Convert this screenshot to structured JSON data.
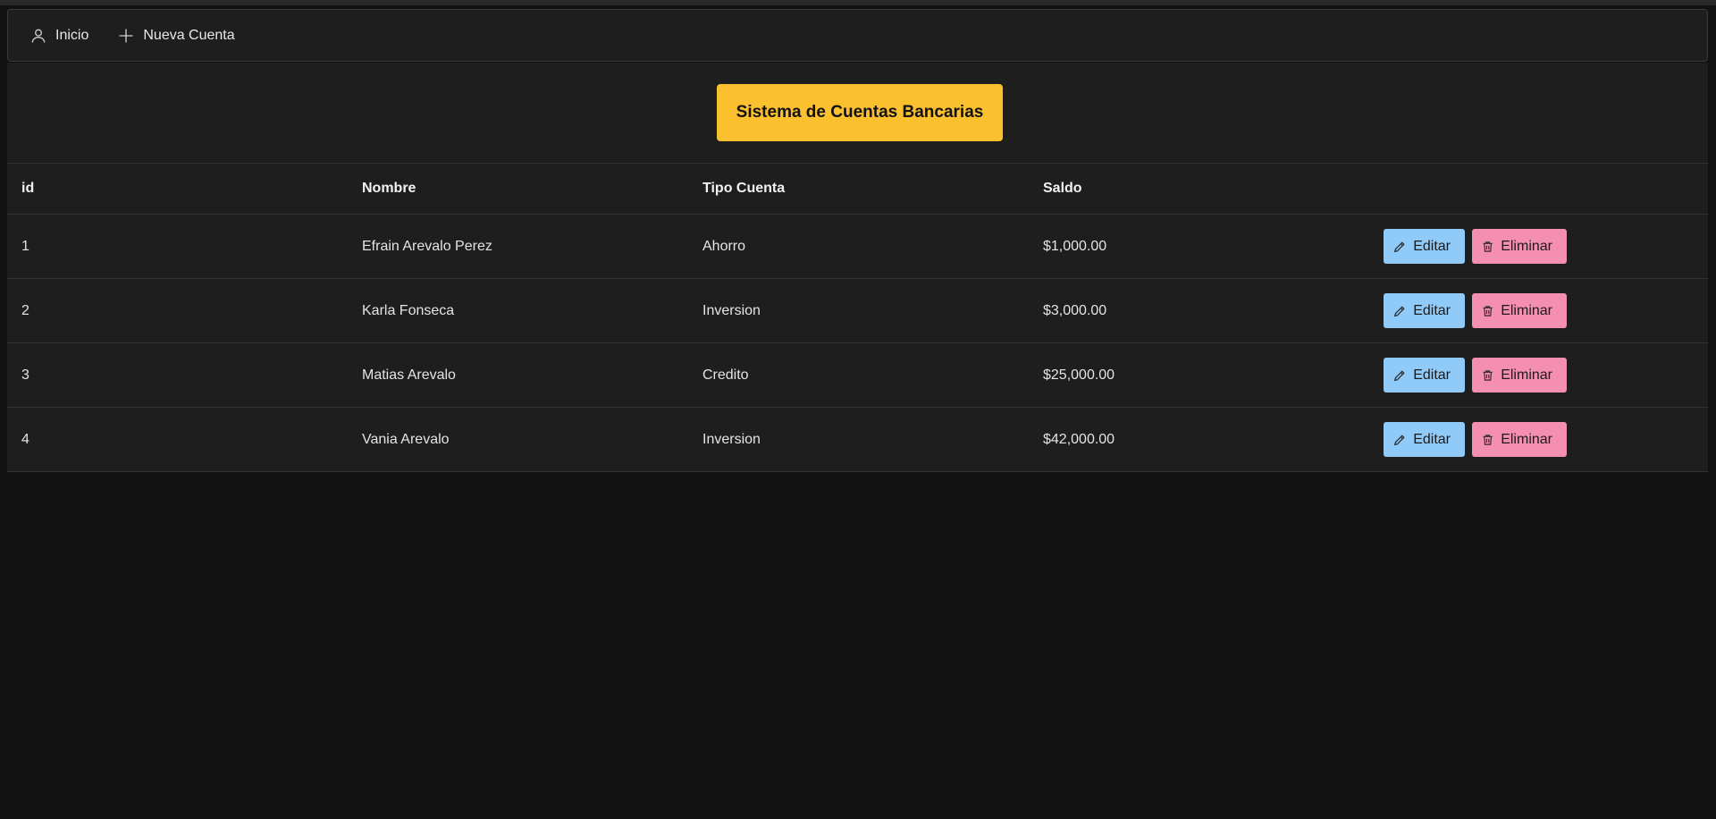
{
  "menubar": {
    "items": [
      {
        "label": "Inicio",
        "icon": "user-icon"
      },
      {
        "label": "Nueva Cuenta",
        "icon": "plus-icon"
      }
    ]
  },
  "header": {
    "title": "Sistema de Cuentas Bancarias"
  },
  "colors": {
    "accent": "#fbc02d",
    "edit": "#90caf9",
    "delete": "#f48fb1",
    "background": "#121212",
    "panel": "#1e1e1e"
  },
  "table": {
    "columns": [
      "id",
      "Nombre",
      "Tipo Cuenta",
      "Saldo",
      ""
    ],
    "rows": [
      {
        "id": "1",
        "nombre": "Efrain Arevalo Perez",
        "tipo": "Ahorro",
        "saldo": "$1,000.00"
      },
      {
        "id": "2",
        "nombre": "Karla Fonseca",
        "tipo": "Inversion",
        "saldo": "$3,000.00"
      },
      {
        "id": "3",
        "nombre": "Matias Arevalo",
        "tipo": "Credito",
        "saldo": "$25,000.00"
      },
      {
        "id": "4",
        "nombre": "Vania Arevalo",
        "tipo": "Inversion",
        "saldo": "$42,000.00"
      }
    ],
    "edit_label": "Editar",
    "delete_label": "Eliminar"
  }
}
